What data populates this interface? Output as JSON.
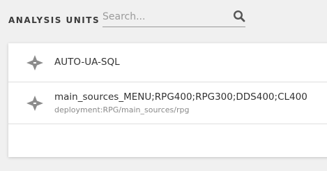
{
  "header": {
    "title": "ANALYSIS UNITS",
    "search": {
      "placeholder": "Search...",
      "value": "",
      "icon": "search-icon"
    }
  },
  "units": [
    {
      "icon": "analysis-unit-icon",
      "name": "AUTO-UA-SQL",
      "subtitle": ""
    },
    {
      "icon": "analysis-unit-icon",
      "name": "main_sources_MENU;RPG400;RPG300;DDS400;CL400",
      "subtitle": "deployment:RPG/main_sources/rpg"
    }
  ],
  "colors": {
    "background": "#f0f0f0",
    "panel": "#ffffff",
    "icon": "#8c8c8c",
    "text": "#333333",
    "muted": "#8a8a8a"
  }
}
